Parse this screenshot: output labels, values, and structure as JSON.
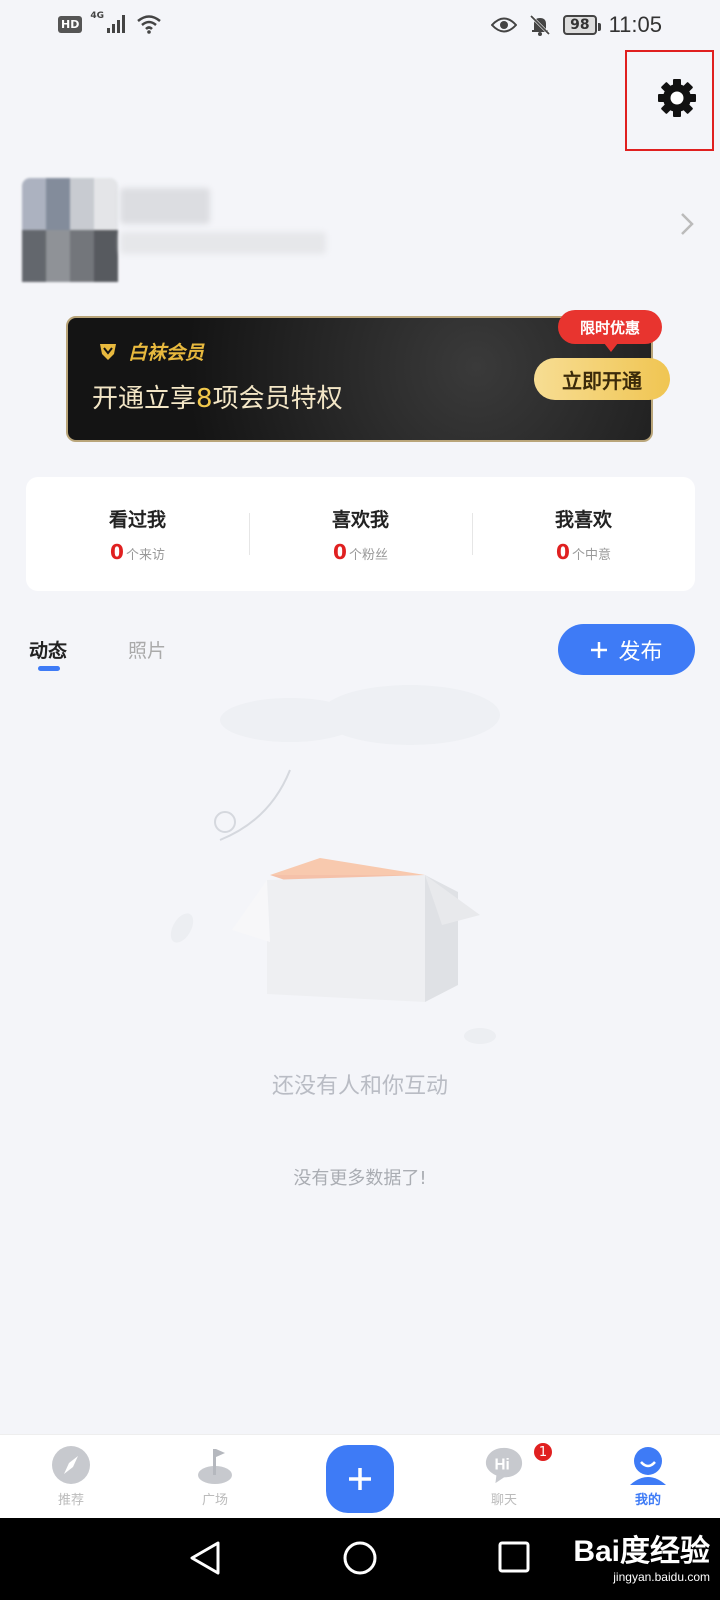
{
  "status_bar": {
    "hd": "HD",
    "network": "4G",
    "battery": "98",
    "time": "11:05"
  },
  "vip": {
    "brand": "白袜会员",
    "title_prefix": "开通立享",
    "title_highlight": "8",
    "title_suffix": "项会员特权",
    "promo": "限时优惠",
    "button": "立即开通"
  },
  "stats": [
    {
      "label": "看过我",
      "count": "0",
      "unit": "个来访"
    },
    {
      "label": "喜欢我",
      "count": "0",
      "unit": "个粉丝"
    },
    {
      "label": "我喜欢",
      "count": "0",
      "unit": "个中意"
    }
  ],
  "tabs": {
    "active": "动态",
    "inactive": "照片",
    "publish": "发布"
  },
  "empty": {
    "message": "还没有人和你互动",
    "no_more": "没有更多数据了!"
  },
  "bottom_nav": {
    "items": [
      {
        "label": "推荐",
        "icon": "compass-icon"
      },
      {
        "label": "广场",
        "icon": "flag-icon"
      },
      {
        "label": "",
        "icon": "plus-icon"
      },
      {
        "label": "聊天",
        "icon": "chat-hi-icon",
        "badge": "1"
      },
      {
        "label": "我的",
        "icon": "profile-icon"
      }
    ]
  },
  "watermark": {
    "logo": "Bai度经验",
    "url": "jingyan.baidu.com"
  },
  "colors": {
    "accent": "#3e7bf6",
    "alert": "#e02020",
    "vip_gold": "#f0c552",
    "background": "#f4f5f9"
  }
}
